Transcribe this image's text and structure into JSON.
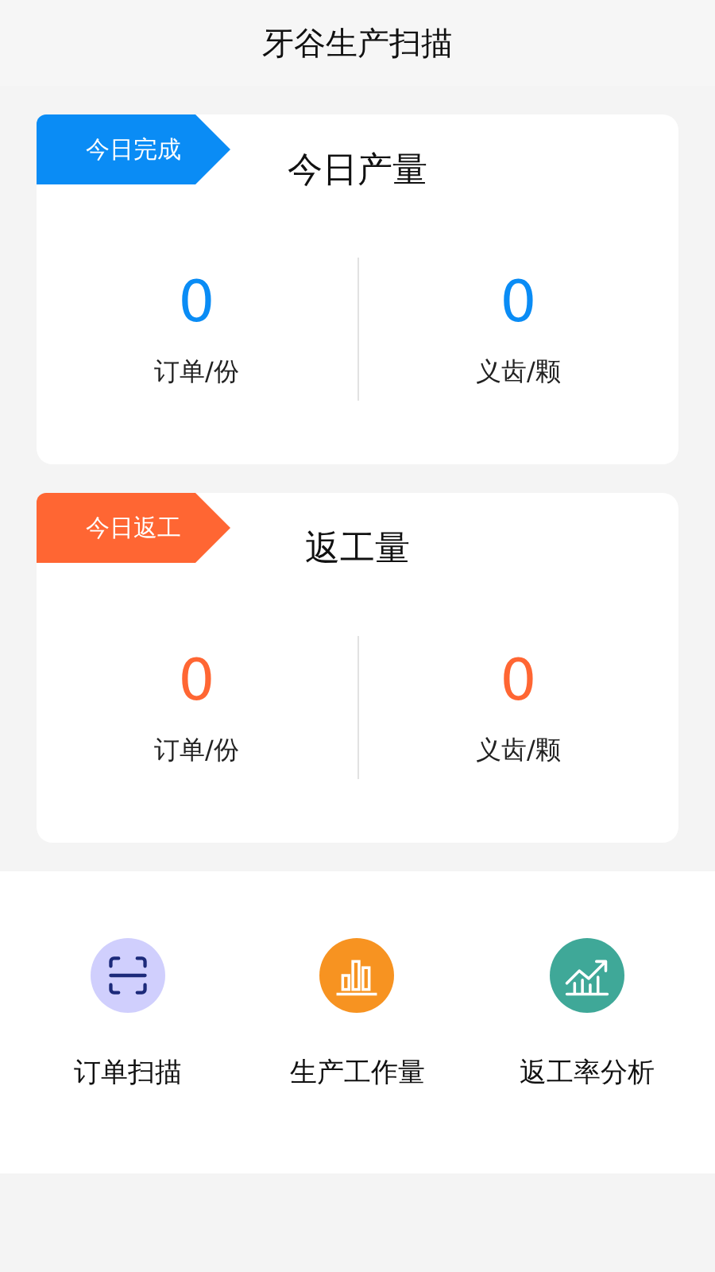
{
  "header": {
    "title": "牙谷生产扫描"
  },
  "cards": [
    {
      "tag": "今日完成",
      "title": "今日产量",
      "color": "#0a8cf5",
      "stats": [
        {
          "value": "0",
          "label": "订单/份"
        },
        {
          "value": "0",
          "label": "义齿/颗"
        }
      ]
    },
    {
      "tag": "今日返工",
      "title": "返工量",
      "color": "#ff6633",
      "stats": [
        {
          "value": "0",
          "label": "订单/份"
        },
        {
          "value": "0",
          "label": "义齿/颗"
        }
      ]
    }
  ],
  "actions": [
    {
      "kind": "scan",
      "label": "订单扫描",
      "color": "#d0cffd"
    },
    {
      "kind": "bars",
      "label": "生产工作量",
      "color": "#f79321"
    },
    {
      "kind": "trend",
      "label": "返工率分析",
      "color": "#3fa898"
    }
  ]
}
